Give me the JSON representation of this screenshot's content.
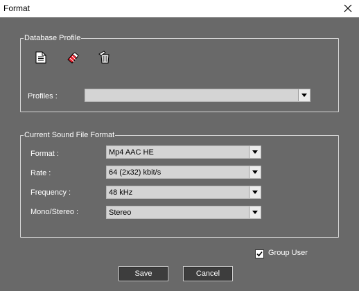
{
  "window": {
    "title": "Format",
    "close_icon": "close-icon"
  },
  "database_profile": {
    "legend": "Database Profile",
    "toolbar": [
      "new-document-icon",
      "eraser-icon",
      "delete-bin-icon"
    ],
    "profiles_label": "Profiles :",
    "profiles_value": ""
  },
  "sound_format": {
    "legend": "Current Sound File Format",
    "format_label": "Format :",
    "format_value": "Mp4 AAC HE",
    "rate_label": "Rate :",
    "rate_value": "64 (2x32) kbit/s",
    "frequency_label": "Frequency :",
    "frequency_value": "48 kHz",
    "mono_stereo_label": "Mono/Stereo :",
    "mono_stereo_value": "Stereo"
  },
  "group_user": {
    "label": "Group User",
    "checked": true
  },
  "buttons": {
    "save": "Save",
    "cancel": "Cancel"
  }
}
